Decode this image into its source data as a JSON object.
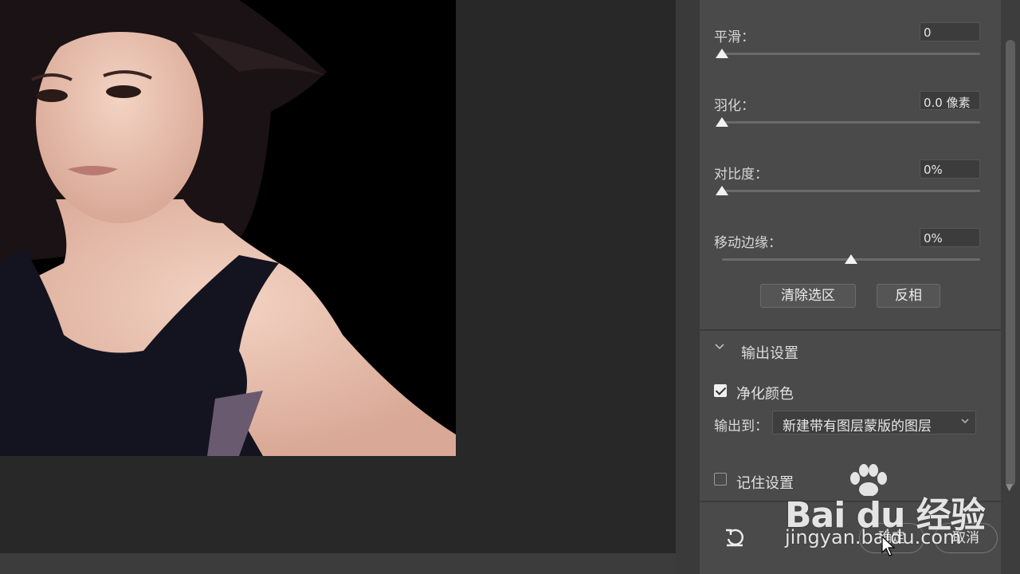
{
  "panel": {
    "params": [
      {
        "label": "平滑：",
        "value": "0",
        "level": 0
      },
      {
        "label": "羽化：",
        "value": "0.0 像素",
        "level": 0
      },
      {
        "label": "对比度：",
        "value": "0%",
        "level": 0
      },
      {
        "label": "移动边缘：",
        "value": "0%",
        "level": 0.5
      }
    ],
    "buttons": {
      "clear_selection": "清除选区",
      "invert": "反相"
    },
    "output_section": {
      "title": "输出设置",
      "decontaminate_label": "净化颜色",
      "decontaminate_checked": true,
      "output_to_label": "输出到：",
      "output_to_value": "新建带有图层蒙版的图层",
      "remember_label": "记住设置",
      "remember_checked": false
    },
    "footer": {
      "ok_label": "确定",
      "cancel_label": "取消"
    }
  },
  "watermark": {
    "brand": "Bai du 经验",
    "url": "jingyan.baidu.com"
  },
  "colors": {
    "panel_bg": "#4a4a4a",
    "canvas_bg": "#282828",
    "image_bg": "#000000"
  },
  "icons": [
    "reset-icon",
    "chevron-down-icon",
    "select-arrow-icon",
    "check-icon",
    "cursor-icon"
  ]
}
